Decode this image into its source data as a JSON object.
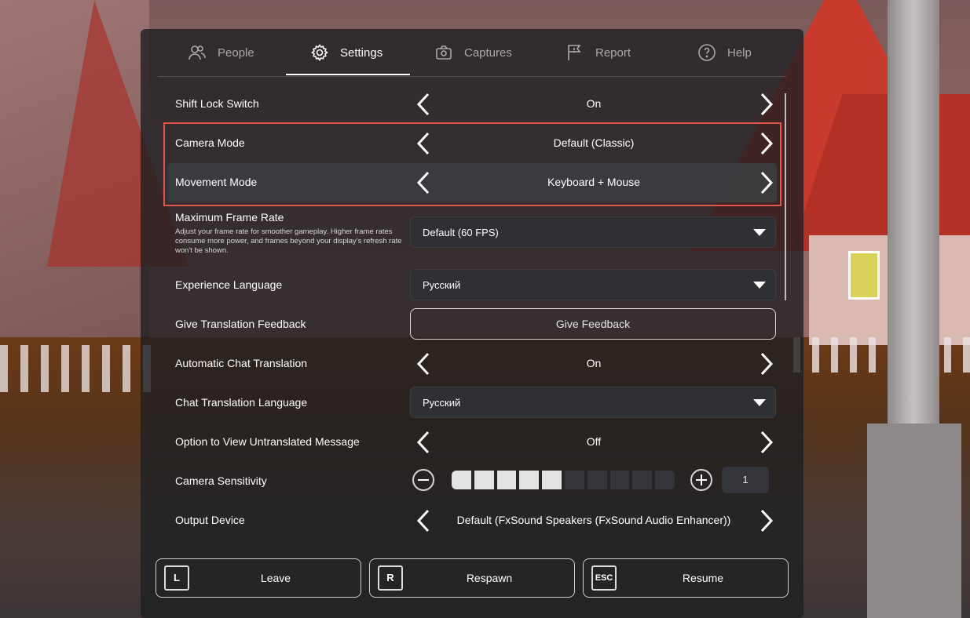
{
  "tabs": [
    {
      "label": "People",
      "icon": "people-icon"
    },
    {
      "label": "Settings",
      "icon": "gear-icon"
    },
    {
      "label": "Captures",
      "icon": "camera-icon"
    },
    {
      "label": "Report",
      "icon": "flag-icon"
    },
    {
      "label": "Help",
      "icon": "help-icon"
    }
  ],
  "active_tab": "Settings",
  "settings": {
    "shift_lock": {
      "label": "Shift Lock Switch",
      "value": "On"
    },
    "camera_mode": {
      "label": "Camera Mode",
      "value": "Default (Classic)"
    },
    "movement_mode": {
      "label": "Movement Mode",
      "value": "Keyboard + Mouse"
    },
    "frame_rate": {
      "label": "Maximum Frame Rate",
      "description": "Adjust your frame rate for smoother gameplay. Higher frame rates consume more power, and frames beyond your display's refresh rate won't be shown.",
      "value": "Default (60 FPS)"
    },
    "experience_language": {
      "label": "Experience Language",
      "value": "Русский"
    },
    "translation_feedback": {
      "label": "Give Translation Feedback",
      "button": "Give Feedback"
    },
    "auto_chat_translation": {
      "label": "Automatic Chat Translation",
      "value": "On"
    },
    "chat_translation_language": {
      "label": "Chat Translation Language",
      "value": "Русский"
    },
    "untranslated_option": {
      "label": "Option to View Untranslated Message",
      "value": "Off"
    },
    "camera_sensitivity": {
      "label": "Camera Sensitivity",
      "value": "1",
      "filled_segments": 5,
      "total_segments": 10
    },
    "output_device": {
      "label": "Output Device",
      "value": "Default (FxSound Speakers (FxSound Audio Enhancer))"
    }
  },
  "bottom_buttons": [
    {
      "key": "L",
      "label": "Leave"
    },
    {
      "key": "R",
      "label": "Respawn"
    },
    {
      "key": "ESC",
      "label": "Resume"
    }
  ],
  "colors": {
    "highlight_border": "#e0564c",
    "panel_bg": "#1e1f22"
  }
}
